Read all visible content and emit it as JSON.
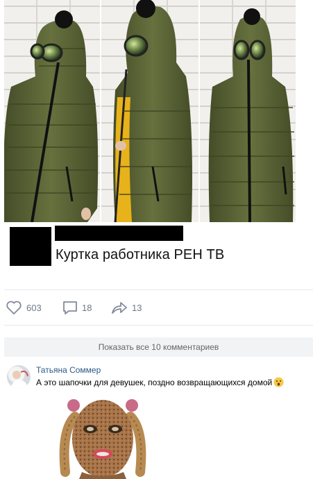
{
  "post": {
    "caption": "Куртка работника РЕН ТВ",
    "photo_icon": "jacket-photo"
  },
  "actions": {
    "likes": "603",
    "comments": "18",
    "shares": "13",
    "like_icon": "heart-icon",
    "comment_icon": "comment-icon",
    "share_icon": "share-arrow-icon"
  },
  "show_all_comments": "Показать все 10 комментариев",
  "comment": {
    "author": "Татьяна Соммер",
    "text": "А это шапочки для девушек, поздно возвращающихся домой",
    "emoji": "surprised-face-emoji",
    "image_icon": "knitted-mask-photo"
  },
  "colors": {
    "link": "#2a5885",
    "count": "#6f7985",
    "jacket": "#5a6536",
    "show_all_bg": "#f2f3f5"
  }
}
